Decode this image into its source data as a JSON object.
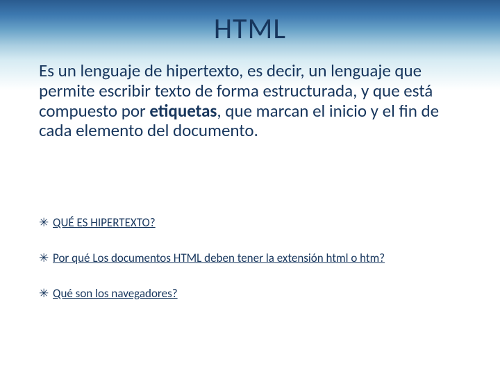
{
  "slide": {
    "title": "HTML",
    "paragraph_before_bold": "Es un lenguaje de hipertexto, es decir, un lenguaje que permite escribir texto de forma estructurada, y que está compuesto por ",
    "paragraph_bold": "etiquetas",
    "paragraph_after_bold": ", que marcan el inicio y el fin de cada elemento del documento.",
    "links": [
      {
        "label": "QUÉ ES HIPERTEXTO?"
      },
      {
        "label": "Por qué Los documentos HTML deben tener la extensión html o htm?"
      },
      {
        "label": "Qué son los navegadores?"
      }
    ],
    "bullet_glyph": "✳"
  }
}
